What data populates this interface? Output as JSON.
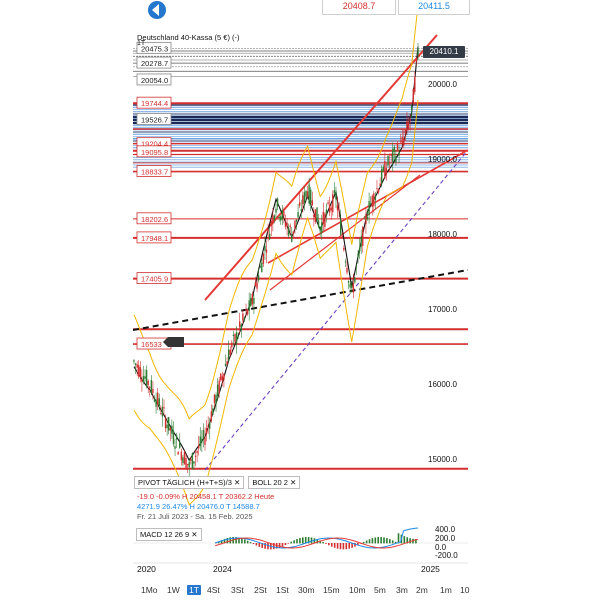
{
  "header": {
    "bid": "20408.7",
    "ask": "20411.5",
    "title": "Deutschland 40-Kassa (5 €) (-)",
    "timeframe_badge": "1T",
    "current_price_tag": "20410.1",
    "bid_color": "#d32f2f",
    "ask_color": "#1e88e5"
  },
  "legend": {
    "pivot_chip": "PIVOT TÄGLICH (H+T+S)/3",
    "boll_chip": "BOLL 20 2",
    "close_icon": "close-icon",
    "line2": "-19.0   -0.09%   H 20458.1  T 20362.2  Heute",
    "line3": "4271.9  26.47%  H 20476.0  T 14588.7",
    "line4": "Fr. 21 Juli 2023 - Sa. 15 Feb. 2025"
  },
  "macd": {
    "label": "MACD 12 26 9",
    "ticks": [
      "400.0",
      "200.0",
      "0.0",
      "-200.0"
    ]
  },
  "x_axis": {
    "labels": [
      "2020",
      "2024",
      "2025"
    ]
  },
  "timeframes": [
    "1Mo",
    "1W",
    "1T",
    "4St",
    "3St",
    "2St",
    "1St",
    "30m",
    "15m",
    "10m",
    "5m",
    "3m",
    "2m",
    "1m",
    "10"
  ],
  "selected_timeframe": "1T",
  "chart_data": {
    "type": "candlestick",
    "y_ticks": [
      "20000.0",
      "19000.0",
      "18000.0",
      "17000.0",
      "16000.0",
      "15000.0"
    ],
    "level_labels": [
      {
        "text": "20475.3",
        "value": 20475.3
      },
      {
        "text": "20278.7",
        "value": 20278.7
      },
      {
        "text": "20054.0",
        "value": 20054.0
      },
      {
        "text": "19744.4",
        "value": 19744.4
      },
      {
        "text": "19526.7",
        "value": 19526.7
      },
      {
        "text": "19204.4",
        "value": 19204.4
      },
      {
        "text": "19095.8",
        "value": 19095.8
      },
      {
        "text": "18833.7",
        "value": 18833.7
      },
      {
        "text": "18202.6",
        "value": 18202.6
      },
      {
        "text": "17948.1",
        "value": 17948.1
      },
      {
        "text": "17405.9",
        "value": 17405.9
      },
      {
        "text": "16533",
        "value": 16533
      }
    ],
    "ylim": [
      14500,
      20700
    ],
    "colors": {
      "up": "#2e7d32",
      "down": "#d32f2f",
      "boll": "#f2b600",
      "ma": "#111111",
      "trend": "#e53935",
      "diag": "#6a3fc2"
    }
  }
}
